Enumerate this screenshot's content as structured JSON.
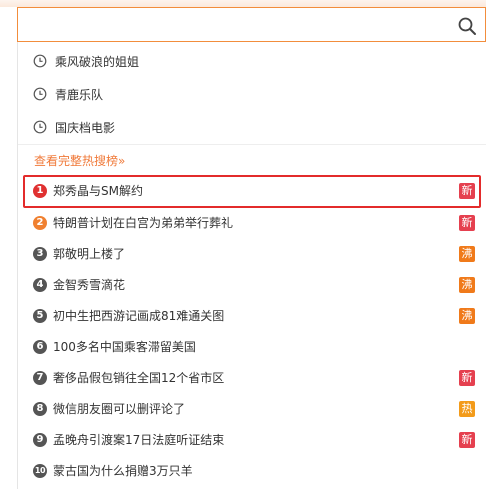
{
  "search": {
    "value": "",
    "placeholder": "",
    "search_icon": "search-icon"
  },
  "history": [
    {
      "label": "乘风破浪的姐姐",
      "icon": "clock-icon"
    },
    {
      "label": "青鹿乐队",
      "icon": "clock-icon"
    },
    {
      "label": "国庆档电影",
      "icon": "clock-icon"
    }
  ],
  "more_link": "查看完整热搜榜»",
  "colors": {
    "accent": "#f07a3a",
    "rank_1": "#e03131",
    "rank_2": "#f08030",
    "rank_default": "#555555",
    "badge_new": "#e5404f",
    "badge_hot": "#f39b1a",
    "badge_boil": "#f07a1a",
    "highlight": "#e32b2b"
  },
  "hot_list": [
    {
      "rank": "1",
      "label": "郑秀晶与SM解约",
      "badge": "新",
      "badge_type": "new"
    },
    {
      "rank": "2",
      "label": "特朗普计划在白宫为弟弟举行葬礼",
      "badge": "新",
      "badge_type": "new"
    },
    {
      "rank": "3",
      "label": "郭敬明上楼了",
      "badge": "沸",
      "badge_type": "boil"
    },
    {
      "rank": "4",
      "label": "金智秀雪滴花",
      "badge": "沸",
      "badge_type": "boil"
    },
    {
      "rank": "5",
      "label": "初中生把西游记画成81难通关图",
      "badge": "沸",
      "badge_type": "boil"
    },
    {
      "rank": "6",
      "label": "100多名中国乘客滞留美国",
      "badge": "",
      "badge_type": ""
    },
    {
      "rank": "7",
      "label": "奢侈品假包销往全国12个省市区",
      "badge": "新",
      "badge_type": "new"
    },
    {
      "rank": "8",
      "label": "微信朋友圈可以删评论了",
      "badge": "热",
      "badge_type": "hot"
    },
    {
      "rank": "9",
      "label": "孟晚舟引渡案17日法庭听证结束",
      "badge": "新",
      "badge_type": "new"
    },
    {
      "rank": "10",
      "label": "蒙古国为什么捐赠3万只羊",
      "badge": "",
      "badge_type": ""
    }
  ]
}
